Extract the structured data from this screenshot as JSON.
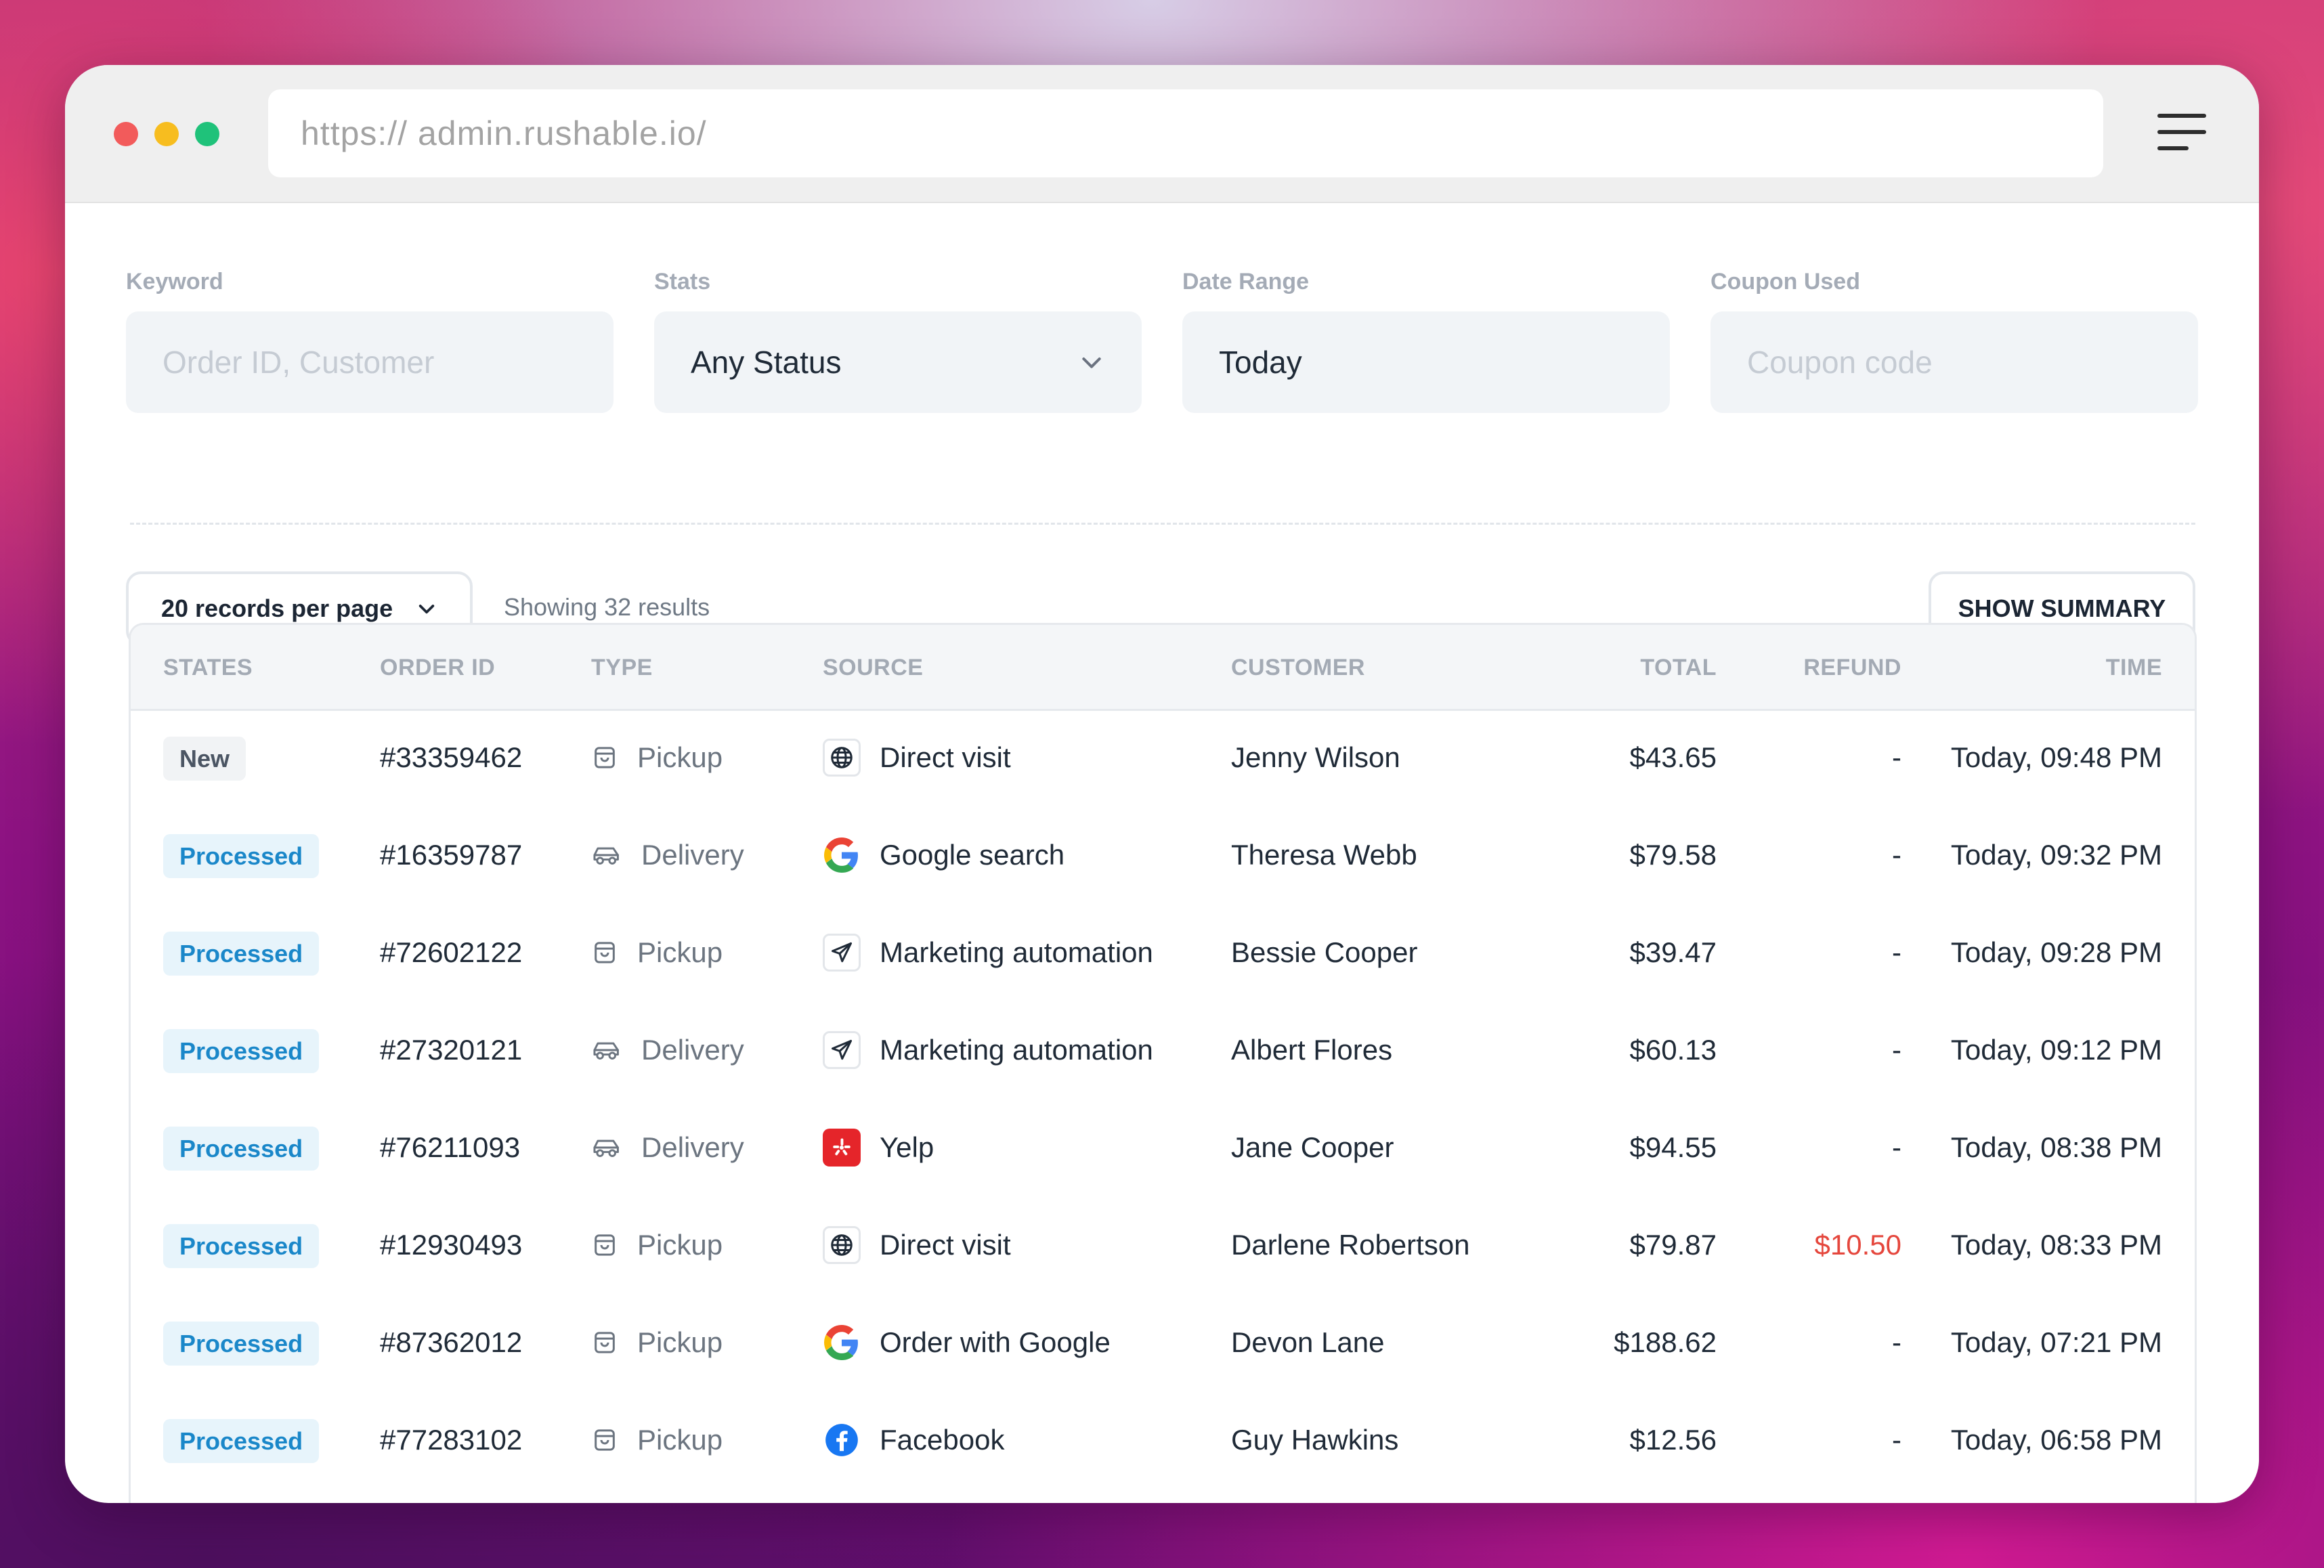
{
  "browser": {
    "url": "https:// admin.rushable.io/"
  },
  "filters": {
    "keyword": {
      "label": "Keyword",
      "placeholder": "Order ID, Customer"
    },
    "stats": {
      "label": "Stats",
      "value": "Any Status"
    },
    "date_range": {
      "label": "Date Range",
      "value": "Today"
    },
    "coupon": {
      "label": "Coupon Used",
      "placeholder": "Coupon code"
    }
  },
  "toolbar": {
    "records_per_page": "20 records per page",
    "showing": "Showing 32 results",
    "show_summary": "SHOW SUMMARY"
  },
  "table": {
    "columns": [
      "STATES",
      "ORDER ID",
      "TYPE",
      "SOURCE",
      "CUSTOMER",
      "TOTAL",
      "REFUND",
      "TIME"
    ],
    "rows": [
      {
        "state": "New",
        "order_id": "#33359462",
        "type": "Pickup",
        "type_icon": "bag-icon",
        "source": "Direct visit",
        "source_icon": "globe-icon",
        "customer": "Jenny Wilson",
        "total": "$43.65",
        "refund": "-",
        "time": "Today, 09:48 PM"
      },
      {
        "state": "Processed",
        "order_id": "#16359787",
        "type": "Delivery",
        "type_icon": "car-icon",
        "source": "Google search",
        "source_icon": "google-icon",
        "customer": "Theresa Webb",
        "total": "$79.58",
        "refund": "-",
        "time": "Today, 09:32 PM"
      },
      {
        "state": "Processed",
        "order_id": "#72602122",
        "type": "Pickup",
        "type_icon": "bag-icon",
        "source": "Marketing automation",
        "source_icon": "paper-plane-icon",
        "customer": "Bessie Cooper",
        "total": "$39.47",
        "refund": "-",
        "time": "Today, 09:28 PM"
      },
      {
        "state": "Processed",
        "order_id": "#27320121",
        "type": "Delivery",
        "type_icon": "car-icon",
        "source": "Marketing automation",
        "source_icon": "paper-plane-icon",
        "customer": "Albert Flores",
        "total": "$60.13",
        "refund": "-",
        "time": "Today, 09:12 PM"
      },
      {
        "state": "Processed",
        "order_id": "#76211093",
        "type": "Delivery",
        "type_icon": "car-icon",
        "source": "Yelp",
        "source_icon": "yelp-icon",
        "customer": "Jane Cooper",
        "total": "$94.55",
        "refund": "-",
        "time": "Today, 08:38 PM"
      },
      {
        "state": "Processed",
        "order_id": "#12930493",
        "type": "Pickup",
        "type_icon": "bag-icon",
        "source": "Direct visit",
        "source_icon": "globe-icon",
        "customer": "Darlene Robertson",
        "total": "$79.87",
        "refund": "$10.50",
        "time": "Today, 08:33 PM"
      },
      {
        "state": "Processed",
        "order_id": "#87362012",
        "type": "Pickup",
        "type_icon": "bag-icon",
        "source": "Order with Google",
        "source_icon": "google-icon",
        "customer": "Devon Lane",
        "total": "$188.62",
        "refund": "-",
        "time": "Today, 07:21 PM"
      },
      {
        "state": "Processed",
        "order_id": "#77283102",
        "type": "Pickup",
        "type_icon": "bag-icon",
        "source": "Facebook",
        "source_icon": "facebook-icon",
        "customer": "Guy Hawkins",
        "total": "$12.56",
        "refund": "-",
        "time": "Today, 06:58 PM"
      }
    ]
  },
  "colors": {
    "processed_badge_text": "#1a87c9",
    "processed_badge_bg": "#e7f4fb",
    "refund_highlight": "#e5473d",
    "yelp_red": "#e5252a",
    "facebook_blue": "#1877f2"
  }
}
